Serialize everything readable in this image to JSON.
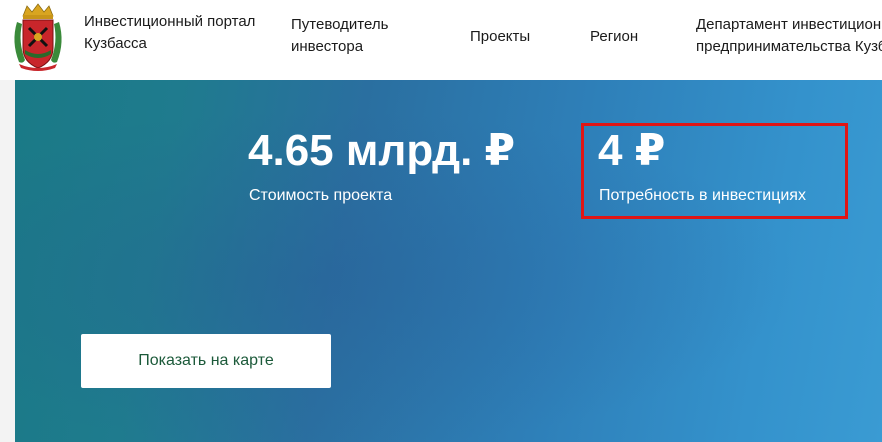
{
  "header": {
    "portal_title": "Инвестиционный портал Кузбасса",
    "logo_icon": "kuzbass-coat-of-arms-icon",
    "nav": {
      "guide": "Путеводитель инвестора",
      "projects": "Проекты",
      "region": "Регион",
      "dept_line1": "Департамент инвестиционной политики и",
      "dept_line2": "предпринимательства Кузбасса"
    }
  },
  "project": {
    "cost_value": "4.65 млрд. ₽",
    "cost_label": "Стоимость проекта",
    "investment_need_value": "4 ₽",
    "investment_need_label": "Потребность в инвестициях",
    "map_button_label": "Показать на карте"
  },
  "colors": {
    "hero_gradient_start": "#1a7a86",
    "hero_gradient_end": "#3a9bd3",
    "highlight_border": "#e01515",
    "button_text": "#1c5a3a"
  }
}
